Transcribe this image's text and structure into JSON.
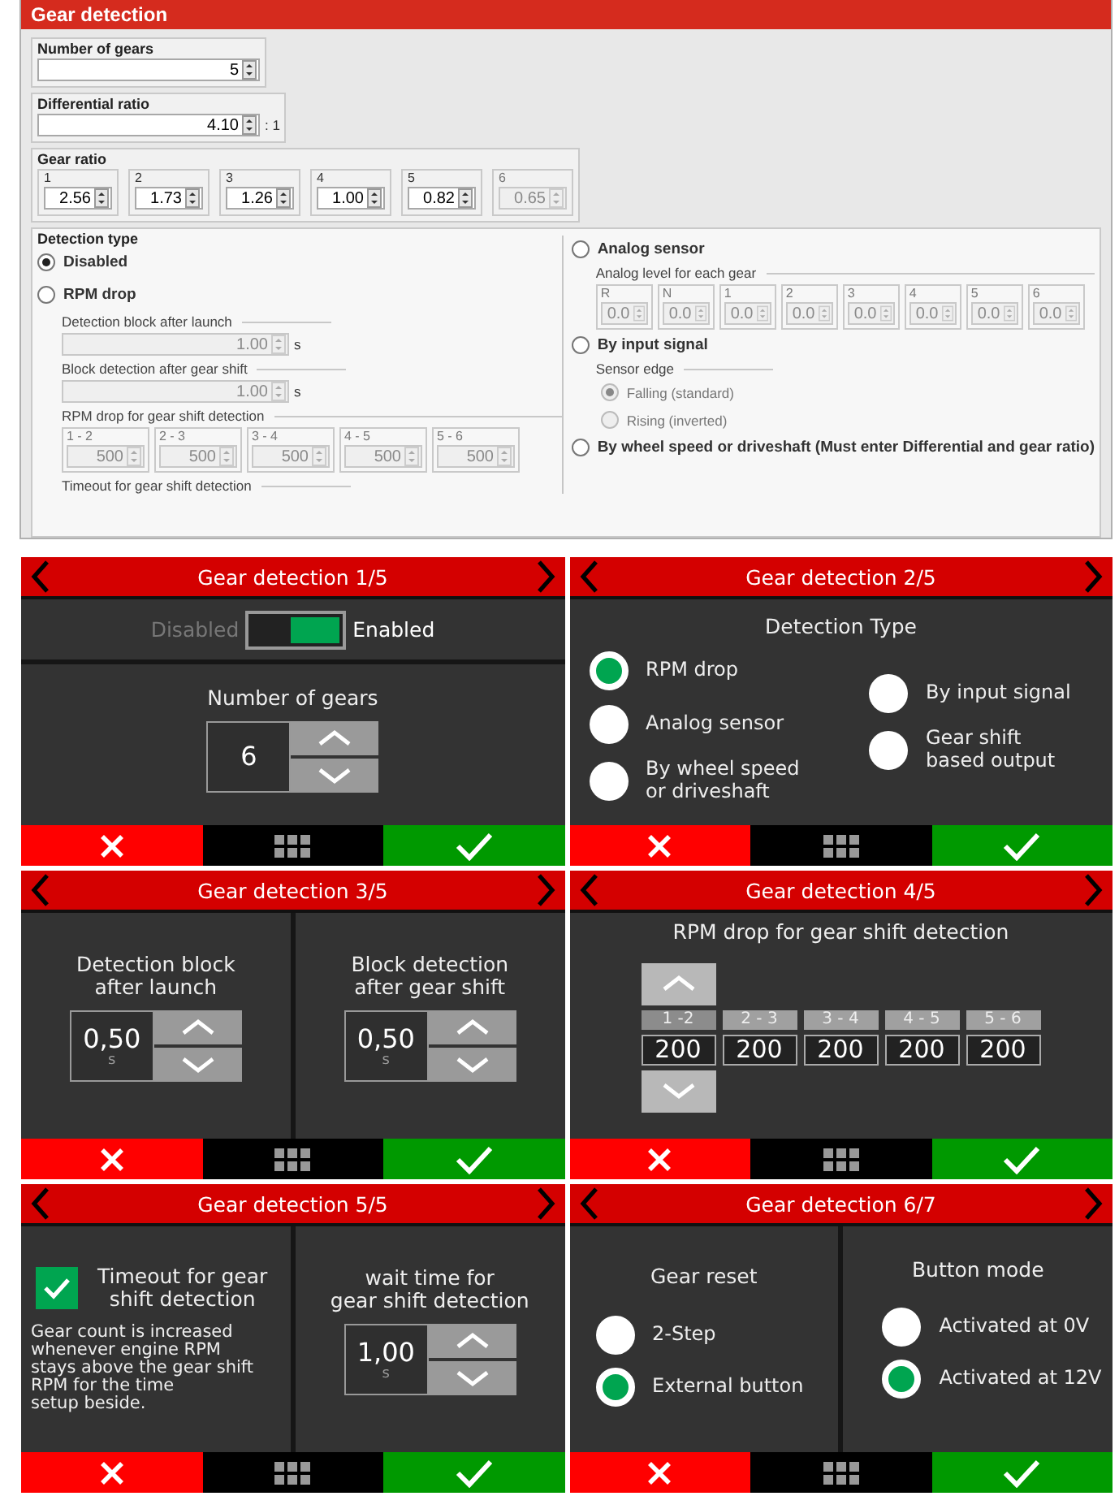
{
  "config_window": {
    "title": "Gear detection",
    "number_of_gears": {
      "label": "Number of gears",
      "value": "5"
    },
    "differential_ratio": {
      "label": "Differential ratio",
      "value": "4.10",
      "suffix": ": 1"
    },
    "gear_ratio": {
      "label": "Gear ratio",
      "gears": [
        {
          "label": "1",
          "value": "2.56",
          "disabled": false
        },
        {
          "label": "2",
          "value": "1.73",
          "disabled": false
        },
        {
          "label": "3",
          "value": "1.26",
          "disabled": false
        },
        {
          "label": "4",
          "value": "1.00",
          "disabled": false
        },
        {
          "label": "5",
          "value": "0.82",
          "disabled": false
        },
        {
          "label": "6",
          "value": "0.65",
          "disabled": true
        }
      ]
    },
    "detection_type": {
      "label": "Detection type",
      "left_options": [
        {
          "label": "Disabled",
          "selected": true
        },
        {
          "label": "RPM drop",
          "selected": false,
          "children": [
            {
              "kind": "spin",
              "label": "Detection block after launch",
              "value": "1.00",
              "unit": "s",
              "disabled": true
            },
            {
              "kind": "spin",
              "label": "Block detection after gear shift",
              "value": "1.00",
              "unit": "s",
              "disabled": true
            },
            {
              "kind": "grid",
              "label": "RPM drop for gear shift detection",
              "disabled": true,
              "items": [
                {
                  "label": "1 - 2",
                  "value": "500"
                },
                {
                  "label": "2 - 3",
                  "value": "500"
                },
                {
                  "label": "3 - 4",
                  "value": "500"
                },
                {
                  "label": "4 - 5",
                  "value": "500"
                },
                {
                  "label": "5 - 6",
                  "value": "500"
                }
              ]
            },
            {
              "kind": "heading",
              "label": "Timeout for gear shift detection"
            }
          ]
        }
      ],
      "right_options": [
        {
          "label": "Analog sensor",
          "selected": false,
          "children": [
            {
              "kind": "grid",
              "label": "Analog level for each gear",
              "disabled": true,
              "items": [
                {
                  "label": "R",
                  "value": "0.0"
                },
                {
                  "label": "N",
                  "value": "0.0"
                },
                {
                  "label": "1",
                  "value": "0.0"
                },
                {
                  "label": "2",
                  "value": "0.0"
                },
                {
                  "label": "3",
                  "value": "0.0"
                },
                {
                  "label": "4",
                  "value": "0.0"
                },
                {
                  "label": "5",
                  "value": "0.0"
                },
                {
                  "label": "6",
                  "value": "0.0"
                }
              ]
            }
          ]
        },
        {
          "label": "By input signal",
          "selected": false,
          "children": [
            {
              "kind": "radios",
              "label": "Sensor edge",
              "disabled": true,
              "options": [
                {
                  "label": "Falling (standard)",
                  "selected": true
                },
                {
                  "label": "Rising (inverted)",
                  "selected": false
                }
              ]
            }
          ]
        },
        {
          "label": "By wheel speed or driveshaft (Must enter Differential and gear ratio)",
          "selected": false
        }
      ]
    }
  },
  "screens": [
    {
      "title": "Gear detection 1/5",
      "panels": [
        {
          "kind": "toggle",
          "off_label": "Disabled",
          "on_label": "Enabled",
          "on": true
        },
        {
          "kind": "spinner",
          "label": "Number of gears",
          "value": "6"
        }
      ]
    },
    {
      "title": "Gear detection 2/5",
      "panels": [
        {
          "kind": "radio_columns",
          "heading": "Detection Type",
          "columns": [
            [
              {
                "label": "RPM drop",
                "selected": true
              },
              {
                "label": "Analog sensor",
                "selected": false
              },
              {
                "label": "By wheel speed\nor driveshaft",
                "selected": false
              }
            ],
            [
              {
                "label": "By input signal",
                "selected": false
              },
              {
                "label": "Gear shift\nbased output",
                "selected": false
              }
            ]
          ]
        }
      ]
    },
    {
      "title": "Gear detection 3/5",
      "panels": [
        {
          "kind": "spinner",
          "label": "Detection block\nafter launch",
          "value": "0,50",
          "unit": "s"
        },
        {
          "kind": "spinner",
          "label": "Block detection\nafter gear shift",
          "value": "0,50",
          "unit": "s"
        }
      ]
    },
    {
      "title": "Gear detection 4/5",
      "panels": [
        {
          "kind": "steps",
          "heading": "RPM drop for gear shift detection",
          "items": [
            {
              "label": "1 -2",
              "value": "200",
              "selected": true
            },
            {
              "label": "2 - 3",
              "value": "200",
              "selected": false
            },
            {
              "label": "3 - 4",
              "value": "200",
              "selected": false
            },
            {
              "label": "4 - 5",
              "value": "200",
              "selected": false
            },
            {
              "label": "5 - 6",
              "value": "200",
              "selected": false
            }
          ]
        }
      ]
    },
    {
      "title": "Gear detection 5/5",
      "panels": [
        {
          "kind": "checkbox",
          "label": "Timeout for gear\nshift detection",
          "checked": true,
          "description": "Gear count is increased\nwhenever engine RPM\nstays above the gear shift\nRPM for the time\nsetup beside."
        },
        {
          "kind": "spinner",
          "label": "wait time for\ngear shift detection",
          "value": "1,00",
          "unit": "s"
        }
      ]
    },
    {
      "title": "Gear detection 6/7",
      "panels": [
        {
          "kind": "radio_group",
          "heading": "Gear reset",
          "options": [
            {
              "label": "2-Step",
              "selected": false
            },
            {
              "label": "External button",
              "selected": true
            }
          ]
        },
        {
          "kind": "radio_group",
          "heading": "Button mode",
          "options": [
            {
              "label": "Activated at 0V",
              "selected": false
            },
            {
              "label": "Activated at 12V",
              "selected": true
            }
          ]
        }
      ]
    }
  ]
}
